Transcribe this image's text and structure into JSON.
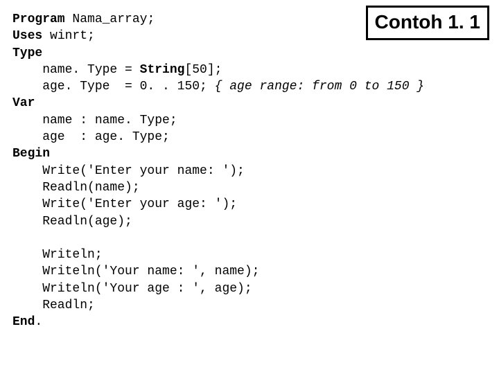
{
  "label": "Contoh 1. 1",
  "code": {
    "l1_kw": "Program",
    "l1_rest": " Nama_array;",
    "l2_kw": "Uses",
    "l2_rest": " winrt;",
    "l3_kw": "Type",
    "l4a": "    name. Type = ",
    "l4b": "String",
    "l4c": "[50];",
    "l5a": "    age. Type  = 0. . 150; ",
    "l5b": "{ age range: from 0 to 150 }",
    "l6_kw": "Var",
    "l7": "    name : name. Type;",
    "l8": "    age  : age. Type;",
    "l9_kw": "Begin",
    "l10": "    Write('Enter your name: ');",
    "l11": "    Readln(name);",
    "l12": "    Write('Enter your age: ');",
    "l13": "    Readln(age);",
    "blank": " ",
    "l14": "    Writeln;",
    "l15": "    Writeln('Your name: ', name);",
    "l16": "    Writeln('Your age : ', age);",
    "l17": "    Readln;",
    "l18_kw": "End",
    "l18_rest": "."
  }
}
